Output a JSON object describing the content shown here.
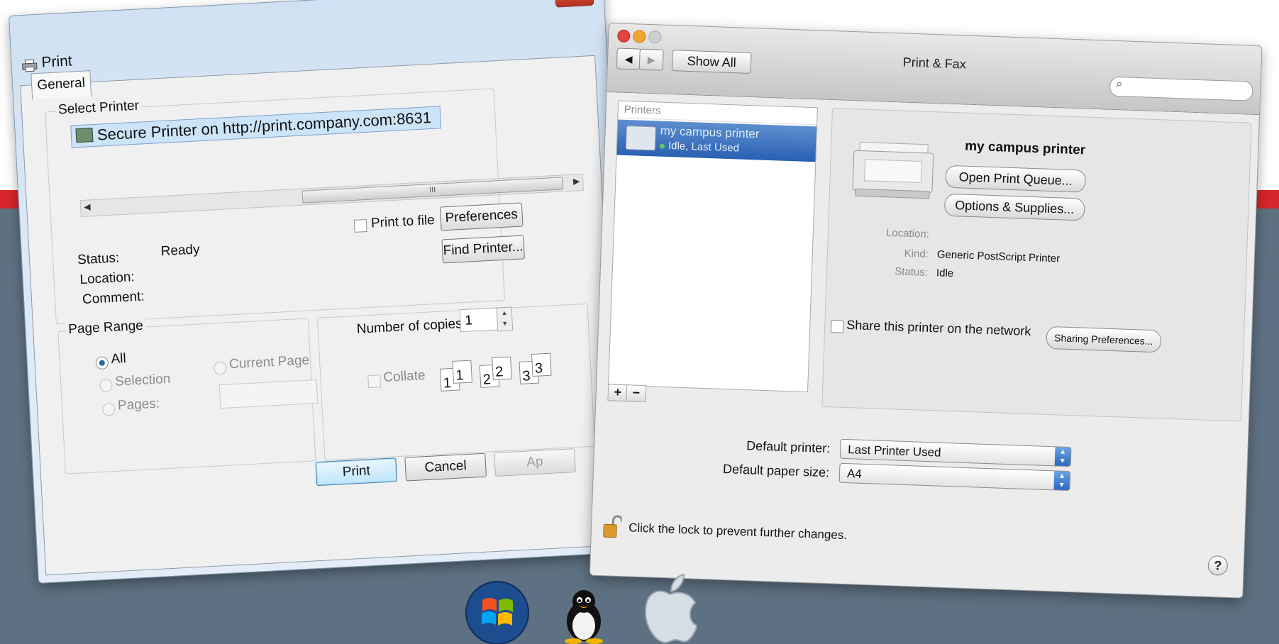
{
  "windows_dialog": {
    "title": "Print",
    "close_label": "✕",
    "tab": "General",
    "select_printer_label": "Select Printer",
    "printer_name": "Secure Printer on http://print.company.com:8631",
    "scroll_thumb": "III",
    "print_to_file_label": "Print to file",
    "preferences_label": "Preferences",
    "find_printer_label": "Find Printer...",
    "status_label": "Status:",
    "status_value": "Ready",
    "location_label": "Location:",
    "comment_label": "Comment:",
    "page_range_label": "Page Range",
    "all_label": "All",
    "selection_label": "Selection",
    "current_page_label": "Current Page",
    "pages_label": "Pages:",
    "copies_label": "Number of copies:",
    "copies_value": "1",
    "collate_label": "Collate",
    "collate_pages": [
      "1",
      "1",
      "2",
      "2",
      "3",
      "3"
    ],
    "print_button": "Print",
    "cancel_button": "Cancel",
    "apply_button": "Ap"
  },
  "mac_dialog": {
    "title": "Print & Fax",
    "show_all": "Show All",
    "search_icon": "⌕",
    "printers_header": "Printers",
    "printer_name": "my campus printer",
    "printer_status": "Idle, Last Used",
    "detail_name": "my campus printer",
    "open_queue_button": "Open Print Queue...",
    "options_button": "Options & Supplies...",
    "location_label": "Location:",
    "kind_label": "Kind:",
    "kind_value": "Generic PostScript Printer",
    "status_label": "Status:",
    "status_value": "Idle",
    "share_label": "Share this printer on the network",
    "sharing_prefs_button": "Sharing Preferences...",
    "default_printer_label": "Default printer:",
    "default_printer_value": "Last Printer Used",
    "default_paper_label": "Default paper size:",
    "default_paper_value": "A4",
    "lock_text": "Click the lock to prevent further changes.",
    "help_label": "?",
    "add_label": "+",
    "remove_label": "−"
  },
  "colors": {
    "stripe": "#d6262b",
    "background": "#5e7182",
    "mac_selection": "#2a60b3"
  },
  "icons": [
    "printer-icon",
    "close-icon",
    "search-icon",
    "lock-icon",
    "help-icon",
    "windows-logo-icon",
    "linux-tux-icon",
    "apple-logo-icon"
  ]
}
